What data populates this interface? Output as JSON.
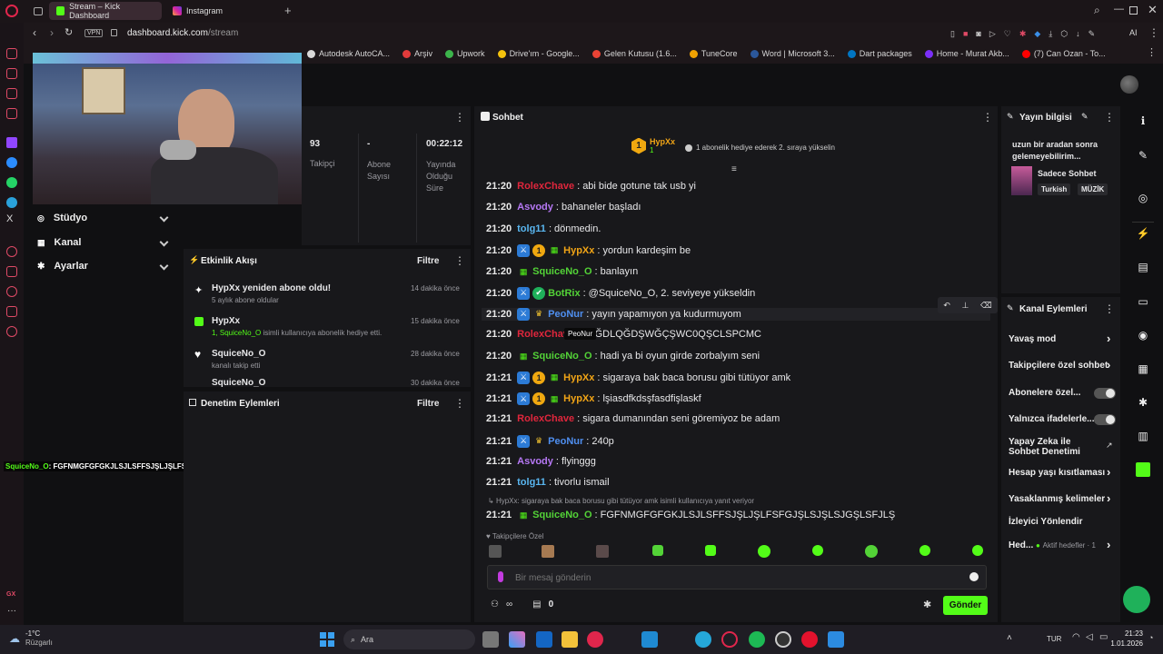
{
  "browser": {
    "tabs": [
      {
        "label": "Stream – Kick Dashboard",
        "active": true
      },
      {
        "label": "Instagram",
        "active": false
      }
    ],
    "vpn_label": "VPN",
    "url_host": "dashboard.kick.com",
    "url_path": "/stream",
    "ai_label": "AI",
    "bookmarks": [
      {
        "label": "Autodesk AutoCA...",
        "color": "#d9d9d9"
      },
      {
        "label": "Arşiv",
        "color": "#e23b3b"
      },
      {
        "label": "Upwork",
        "color": "#3cb44b"
      },
      {
        "label": "Drive'ım - Google...",
        "color": "#f4c20d"
      },
      {
        "label": "Gelen Kutusu (1.6...",
        "color": "#ea4335"
      },
      {
        "label": "TuneCore",
        "color": "#f0a202"
      },
      {
        "label": "Word | Microsoft 3...",
        "color": "#2b579a"
      },
      {
        "label": "Dart packages",
        "color": "#0175c2"
      },
      {
        "label": "Home - Murat Akb...",
        "color": "#7b2ff7"
      },
      {
        "label": "(7) Can Ozan - To...",
        "color": "#ff0000"
      }
    ]
  },
  "nav": {
    "items": [
      {
        "label": "Stüdyo",
        "icon": "studio-icon"
      },
      {
        "label": "Kanal",
        "icon": "channel-icon"
      },
      {
        "label": "Ayarlar",
        "icon": "settings-icon"
      }
    ]
  },
  "stats": [
    {
      "value": "93",
      "label": "Takipçi"
    },
    {
      "value": "-",
      "label": "Abone Sayısı"
    },
    {
      "value": "00:22:12",
      "label": "Yayında Olduğu Süre"
    }
  ],
  "activity": {
    "title": "Etkinlik Akışı",
    "filter": "Filtre",
    "items": [
      {
        "user": "HypXx",
        "title_rest": "yeniden abone oldu!",
        "sub": "5 aylık abone oldular",
        "time": "14 dakika önce",
        "icon": "sparkle-icon"
      },
      {
        "user": "HypXx",
        "sub_user": "1, SquiceNo_O",
        "sub": "isimli kullanıcıya abonelik hediye etti.",
        "time": "15 dakika önce",
        "icon": "gift-icon"
      },
      {
        "user": "SquiceNo_O",
        "sub": "kanalı takip etti",
        "time": "28 dakika önce",
        "icon": "heart-icon"
      },
      {
        "user": "SquiceNo_O",
        "sub": "",
        "time": "30 dakika önce",
        "icon": "heart-icon"
      }
    ]
  },
  "moderation": {
    "title": "Denetim Eylemleri",
    "filter": "Filtre"
  },
  "overlay": {
    "user": "SquiceNo_O",
    "text": ": FGFNMGFGFGKJLSJLSFFSJŞLJŞLFSFGJŞLSJŞLSJGŞLSFJLŞ"
  },
  "chat": {
    "title": "Sohbet",
    "pinned": {
      "user": "HypXx",
      "count": "1",
      "gift_text": "1 abonelik hediye ederek 2. sıraya yükselin"
    },
    "tooltip": "PeoNur",
    "messages": [
      {
        "time": "21:20",
        "badges": [],
        "user": "RolexChave",
        "color": "#e0263c",
        "text": "abi bide gotune tak usb yi"
      },
      {
        "time": "21:20",
        "badges": [],
        "user": "Asvody",
        "color": "#b678f5",
        "text": "bahaneler başladı"
      },
      {
        "time": "21:20",
        "badges": [],
        "user": "tolg11",
        "color": "#59b6f0",
        "text": "dönmedin."
      },
      {
        "time": "21:20",
        "badges": [
          "mod",
          "sub",
          "tier"
        ],
        "user": "HypXx",
        "color": "#f2a516",
        "text": "yordun kardeşim be"
      },
      {
        "time": "21:20",
        "badges": [
          "tier"
        ],
        "user": "SquiceNo_O",
        "color": "#53d337",
        "text": "banlayın"
      },
      {
        "time": "21:20",
        "badges": [
          "mod",
          "ver"
        ],
        "user": "BotRix",
        "color": "#53d337",
        "text": "@SquiceNo_O, 2. seviyeye yükseldin"
      },
      {
        "time": "21:20",
        "badges": [
          "mod",
          "vip"
        ],
        "user": "PeoNur",
        "color": "#4f8ff0",
        "text": "yayın yapamıyon ya kudurmuyom"
      },
      {
        "time": "21:20",
        "badges": [],
        "user": "RolexChave",
        "color": "#e0263c",
        "text": ".WĞDLQĞDŞWĞÇŞWC0QŞCLSPCMC"
      },
      {
        "time": "21:20",
        "badges": [
          "tier"
        ],
        "user": "SquiceNo_O",
        "color": "#53d337",
        "text": "hadi ya bi oyun girde zorbalyım seni"
      },
      {
        "time": "21:21",
        "badges": [
          "mod",
          "sub",
          "tier"
        ],
        "user": "HypXx",
        "color": "#f2a516",
        "text": "sigaraya bak baca borusu gibi tütüyor amk"
      },
      {
        "time": "21:21",
        "badges": [
          "mod",
          "sub",
          "tier"
        ],
        "user": "HypXx",
        "color": "#f2a516",
        "text": "lşiasdfkdsşfasdfişlaskf"
      },
      {
        "time": "21:21",
        "badges": [],
        "user": "RolexChave",
        "color": "#e0263c",
        "text": "sigara dumanından seni göremiyoz be adam"
      },
      {
        "time": "21:21",
        "badges": [
          "mod",
          "vip"
        ],
        "user": "PeoNur",
        "color": "#4f8ff0",
        "text": "240p"
      },
      {
        "time": "21:21",
        "badges": [],
        "user": "Asvody",
        "color": "#b678f5",
        "text": "flyinggg"
      },
      {
        "time": "21:21",
        "badges": [],
        "user": "tolg11",
        "color": "#59b6f0",
        "text": "tivorlu ismail"
      }
    ],
    "reply_ref": "HypXx: sigaraya bak baca borusu gibi tütüyor amk isimli kullanıcıya yanıt veriyor",
    "reply_msg": {
      "time": "21:21",
      "user": "SquiceNo_O",
      "text": "FGFNMGFGFGKJLSJLSFFSJŞLJŞLFSFGJŞLSJŞLSJGŞLSFJLŞ"
    },
    "followers_label": "Takipçilere Özel",
    "input_placeholder": "Bir mesaj gönderin",
    "points": "0",
    "send": "Gönder"
  },
  "stream_info": {
    "title": "Yayın bilgisi",
    "stream_title": "uzun bir aradan sonra gelemeyebilirim...",
    "category": "Sadece Sohbet",
    "tags": [
      "Turkish",
      "MÜZİK"
    ]
  },
  "channel_actions": {
    "title": "Kanal Eylemleri",
    "items": [
      {
        "label": "Yavaş mod",
        "kind": "arrow"
      },
      {
        "label": "Takipçilere özel sohbet",
        "kind": "arrow"
      },
      {
        "label": "Abonelere özel...",
        "kind": "toggle"
      },
      {
        "label": "Yalnızca ifadelerle...",
        "kind": "toggle"
      },
      {
        "label": "Yapay Zeka ile Sohbet Denetimi",
        "kind": "external"
      },
      {
        "label": "Hesap yaşı kısıtlaması",
        "kind": "arrow"
      },
      {
        "label": "Yasaklanmış kelimeler",
        "kind": "arrow"
      },
      {
        "label": "İzleyici Yönlendir",
        "kind": "none"
      },
      {
        "label": "Hed...",
        "extra": "Aktif hedefler · 1",
        "kind": "arrow"
      }
    ]
  },
  "taskbar": {
    "weather_temp": "-1°C",
    "weather_desc": "Rüzgarlı",
    "search": "Ara",
    "lang": "TUR",
    "time": "21:23",
    "date": "1.01.2026"
  },
  "colors": {
    "accent": "#53fc18",
    "opera": "#e0264c"
  }
}
